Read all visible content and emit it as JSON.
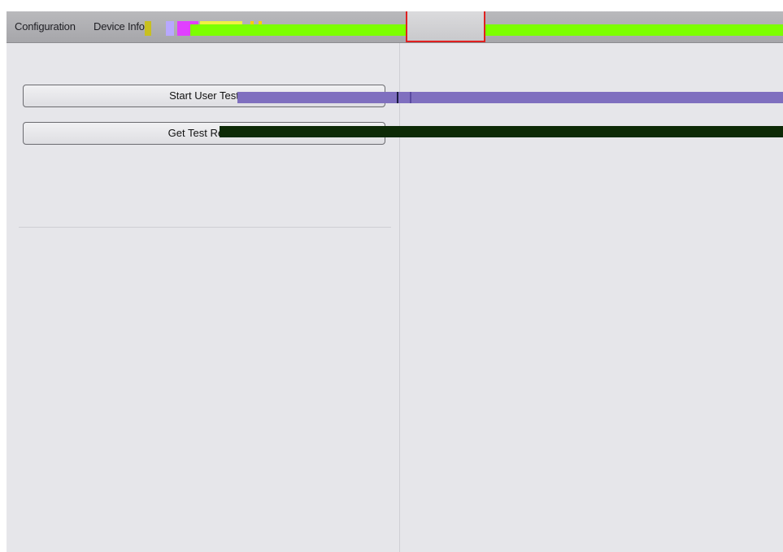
{
  "tabs": [
    {
      "label": "Configuration",
      "active": false
    },
    {
      "label": "Device Info.",
      "active": false
    },
    {
      "label": "",
      "active": true
    }
  ],
  "left_panel": {
    "start_button_label": "Start User Test",
    "second_button_label": "Get Test Result"
  },
  "colors": {
    "active_tab_outline": "#e02020",
    "background": "#e6e6ea"
  }
}
